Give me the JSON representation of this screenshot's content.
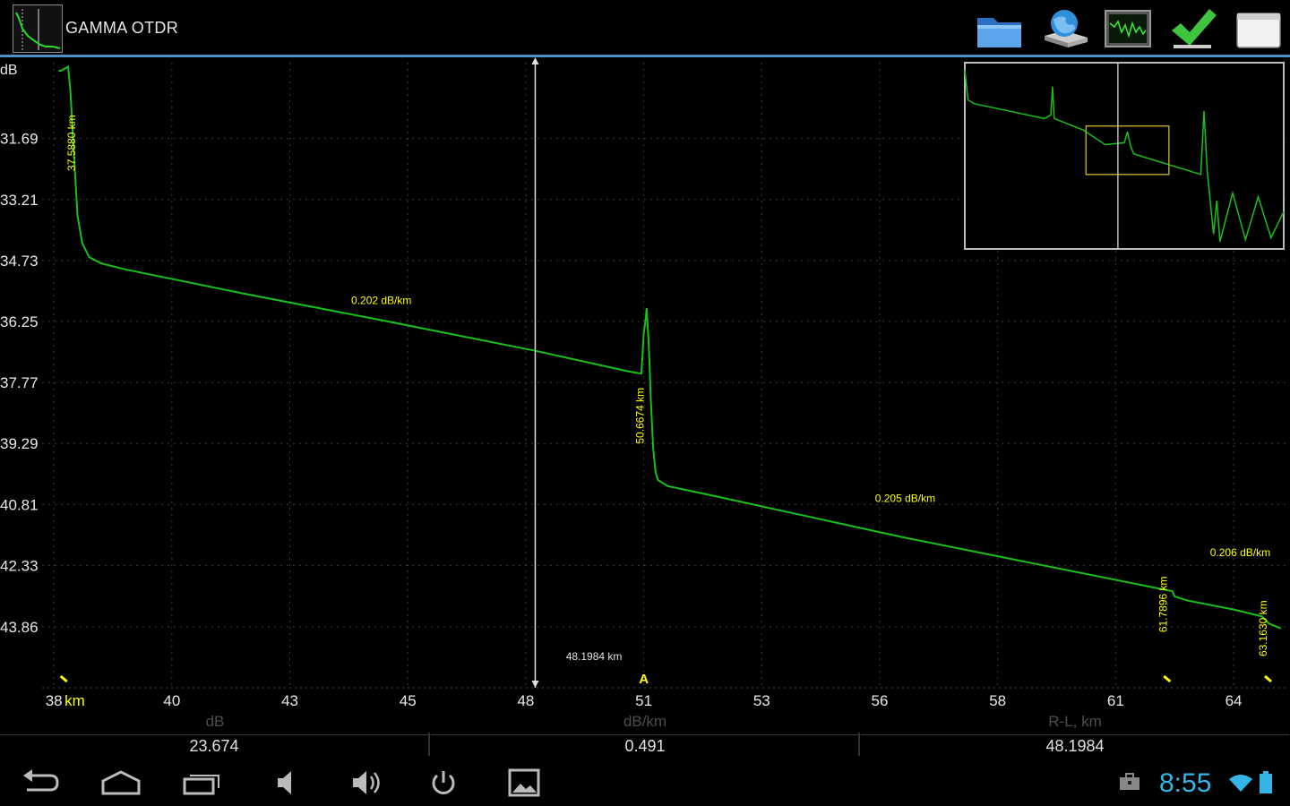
{
  "app": {
    "title": "GAMMA OTDR"
  },
  "toolbar": {
    "buttons": [
      {
        "name": "open-folder-button",
        "icon": "folder-icon"
      },
      {
        "name": "network-drive-button",
        "icon": "globe-drive-icon"
      },
      {
        "name": "trace-view-button",
        "icon": "trace-monitor-icon"
      },
      {
        "name": "confirm-button",
        "icon": "check-icon"
      },
      {
        "name": "blank-window-button",
        "icon": "window-icon"
      }
    ]
  },
  "chart_data": {
    "type": "line",
    "title": "",
    "ylabel": "dB",
    "xlabel": "km",
    "ylim": [
      29.8,
      45.38
    ],
    "xlim": [
      37.75,
      64.1
    ],
    "y_ticks": [
      "31.69",
      "33.21",
      "34.73",
      "36.25",
      "37.77",
      "39.29",
      "40.81",
      "42.33",
      "43.86"
    ],
    "y_tick_values": [
      31.69,
      33.21,
      34.73,
      36.25,
      37.77,
      39.29,
      40.81,
      42.33,
      43.86
    ],
    "x_ticks": [
      "38",
      "40",
      "43",
      "45",
      "48",
      "51",
      "53",
      "56",
      "58",
      "61",
      "64"
    ],
    "x_tick_values": [
      38,
      40.5,
      43,
      45.5,
      48,
      50.5,
      53,
      55.5,
      58,
      60.5,
      63
    ],
    "x_unit_label": "km",
    "grid": true,
    "trace_color": "#19c019",
    "label_color": "#ffff00",
    "series": [
      {
        "x": [
          38.1,
          38.15,
          38.3,
          38.35,
          38.42,
          38.5,
          38.6,
          38.75,
          39.0,
          39.5,
          42.0,
          45.0,
          48.2,
          50.2,
          50.45,
          50.5,
          50.53,
          50.56,
          50.6,
          50.62,
          50.65,
          50.7,
          50.75,
          50.8,
          51.0,
          52.0,
          56.0,
          61.6,
          61.7,
          61.75,
          62.0,
          63.0,
          63.6,
          63.75,
          64.0
        ],
        "y": [
          30.0,
          30.0,
          29.9,
          30.5,
          32.0,
          33.6,
          34.3,
          34.65,
          34.8,
          34.95,
          35.55,
          36.23,
          36.98,
          37.5,
          37.55,
          36.55,
          36.3,
          35.92,
          36.7,
          37.2,
          38.2,
          39.4,
          40.0,
          40.2,
          40.35,
          40.6,
          41.63,
          42.95,
          42.97,
          43.1,
          43.2,
          43.43,
          43.6,
          43.78,
          43.9
        ]
      }
    ],
    "annotations": [
      {
        "text": "37.5880 km",
        "x": 38.45,
        "y": 31.8,
        "orient": "vertical"
      },
      {
        "text": "0.202 dB/km",
        "x": 44.3,
        "y": 35.82,
        "orient": "horizontal"
      },
      {
        "text": "50.6674 km",
        "x": 50.5,
        "y": 38.6,
        "orient": "vertical"
      },
      {
        "text": "0.205 dB/km",
        "x": 55.4,
        "y": 40.75,
        "orient": "horizontal"
      },
      {
        "text": "0.206 dB/km",
        "x": 62.5,
        "y": 42.1,
        "orient": "horizontal"
      },
      {
        "text": "61.7896 km",
        "x": 61.58,
        "y": 43.3,
        "orient": "vertical"
      },
      {
        "text": "63.1630 km",
        "x": 63.7,
        "y": 43.9,
        "orient": "vertical"
      },
      {
        "text": "48.1984 km",
        "x": 48.85,
        "y": 44.69,
        "orient": "horizontal"
      }
    ],
    "event_markers_km": [
      38.2,
      61.58,
      63.72
    ],
    "cursor": {
      "x": 48.2,
      "label": "48.1984 km"
    },
    "cursor_a": {
      "x": 50.5,
      "label": "A"
    },
    "overview": {
      "xlim": [
        0,
        100
      ],
      "ylim": [
        0,
        100
      ],
      "trace": {
        "x": [
          0,
          1,
          3,
          25,
          27,
          27.5,
          28,
          37,
          44,
          50,
          51,
          52,
          53,
          74,
          75,
          76,
          77,
          78,
          79,
          80,
          84,
          88,
          92,
          96,
          100
        ],
        "y": [
          4,
          20,
          22,
          30,
          28,
          13,
          30,
          36,
          44,
          43,
          37,
          45,
          49,
          60,
          26,
          58,
          75,
          92,
          74,
          96,
          70,
          95,
          72,
          94,
          80
        ]
      },
      "zoom_box": {
        "x0": 38,
        "x1": 64,
        "y0": 34,
        "y1": 60
      },
      "cursor_x": 48
    }
  },
  "readout": {
    "labels": [
      "dB",
      "dB/km",
      "R-L, km"
    ],
    "values": [
      "23.674",
      "0.491",
      "48.1984"
    ]
  },
  "navbar": {
    "buttons": [
      {
        "name": "back-button",
        "icon": "back-arrow-icon"
      },
      {
        "name": "home-button",
        "icon": "home-icon"
      },
      {
        "name": "recent-apps-button",
        "icon": "recent-apps-icon"
      },
      {
        "name": "volume-down-button",
        "icon": "volume-down-icon"
      },
      {
        "name": "volume-up-button",
        "icon": "volume-up-icon"
      },
      {
        "name": "power-button",
        "icon": "power-icon"
      },
      {
        "name": "screenshot-button",
        "icon": "image-icon"
      }
    ],
    "clock": "8:55"
  }
}
